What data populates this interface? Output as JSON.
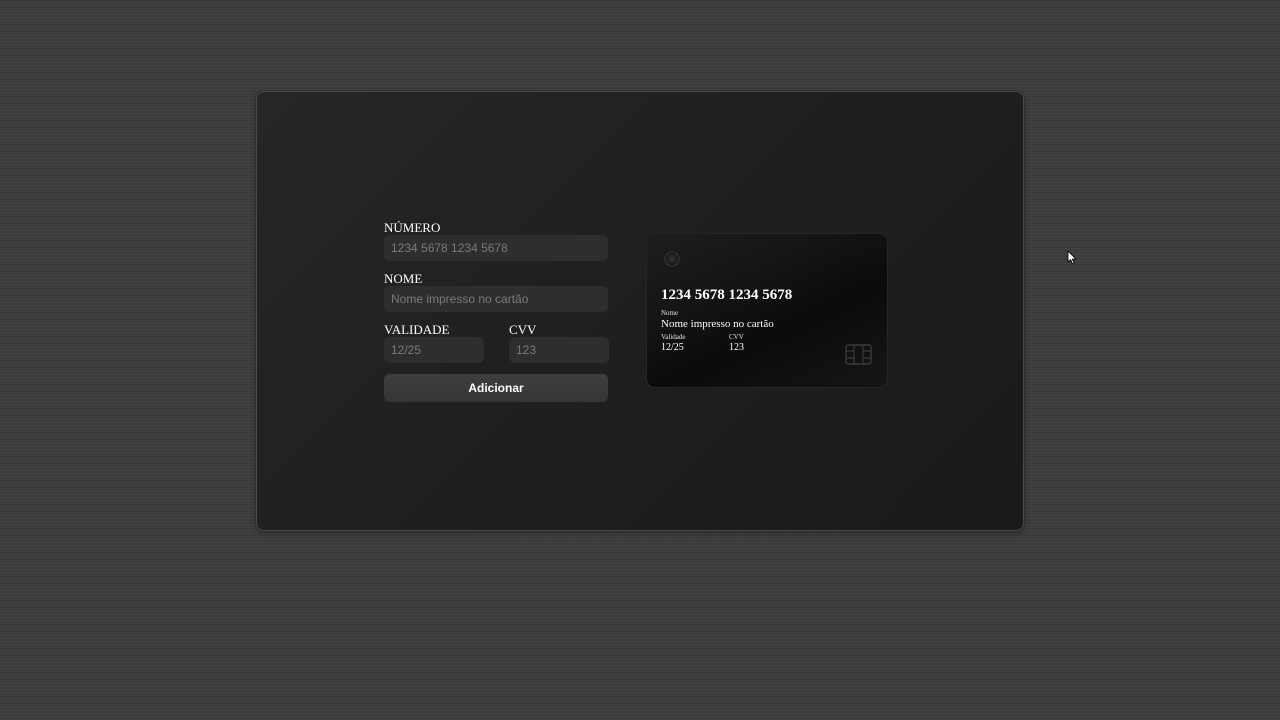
{
  "form": {
    "numero": {
      "label": "NÚMERO",
      "placeholder": "1234 5678 1234 5678",
      "value": ""
    },
    "nome": {
      "label": "NOME",
      "placeholder": "Nome impresso no cartão",
      "value": ""
    },
    "validade": {
      "label": "VALIDADE",
      "placeholder": "12/25",
      "value": ""
    },
    "cvv": {
      "label": "CVV",
      "placeholder": "123",
      "value": ""
    },
    "submit_label": "Adicionar"
  },
  "card": {
    "logo_icon": "card-brand-icon",
    "chip_icon": "card-chip-icon",
    "number": "1234 5678 1234 5678",
    "name_label": "Nome",
    "name": "Nome impresso no cartão",
    "validity_label": "Validade",
    "validity": "12/25",
    "cvv_label": "CVV",
    "cvv": "123"
  },
  "colors": {
    "background": "#3c3c3c",
    "panel": "#222222",
    "input": "#2e2e2e",
    "button": "#3a3a3a",
    "card": "#111111",
    "text": "#ffffff",
    "placeholder": "#7a7a7a"
  }
}
